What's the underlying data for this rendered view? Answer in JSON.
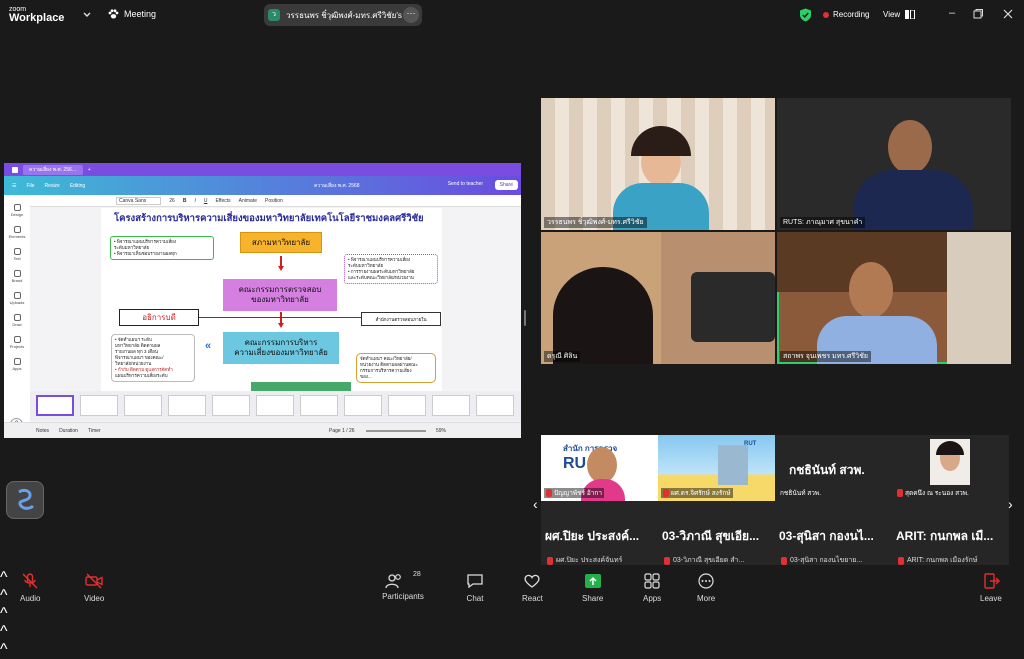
{
  "app": {
    "brand_line1": "zoom",
    "brand_line2": "Workplace",
    "meeting_label": "Meeting",
    "share_tab_title": "วรรธนพร  ชิ๋วุฒิพงศ์-มทร.ศรีวิชัย's sc",
    "share_tab_icon": "ว",
    "recording_label": "Recording",
    "view_label": "View"
  },
  "canva": {
    "tab_title": "ความเสี่ยง พ.ศ. 256…",
    "menu": [
      "File",
      "Resize",
      "Editing"
    ],
    "doc_title": "ความเสี่ยง พ.ศ. 2568",
    "send_to_teacher": "Send to teacher",
    "share_label": "Share",
    "font_name": "Canva Sans",
    "font_size": "26",
    "tool_items": [
      "Effects",
      "Animate",
      "Position"
    ],
    "left_panel": [
      "Design",
      "Elements",
      "Text",
      "Brand",
      "Uploads",
      "Draw",
      "Projects",
      "Apps"
    ],
    "slide": {
      "title": "โครงสร้างการบริหารความเสี่ยงของมหาวิทยาลัยเทคโนโลยีราชมงคลศรีวิชัย",
      "box1": "สภามหาวิทยาลัย",
      "box2_line1": "คณะกรรมการตรวจสอบ",
      "box2_line2": "ของมหาวิทยาลัย",
      "box3_line1": "คณะกรรมการบริหาร",
      "box3_line2": "ความเสี่ยงของมหาวิทยาลัย",
      "box_left": "อธิการบดี",
      "box_right": "สำนักงานตรวจสอบภายใน",
      "note_tl_1": "• พิจารณาแผนบริหารความเสี่ยง",
      "note_tl_2": "ระดับมหาวิทยาลัย",
      "note_tl_3": "• พิจารณาเห็นชอบรายงานผลทุก",
      "note_tr_1": "• พิจารณาแผนบริหารความเสี่ยง",
      "note_tr_2": "ระดับมหาวิทยาลัย",
      "note_tr_3": "• การรายงานผลระดับมหาวิทยาลัย",
      "note_tr_4": "และระดับคณะ/วิทยาลัย/หน่วยงาน",
      "note_bl_1": "• จัดทำแผนฯ ระดับ",
      "note_bl_2": "มหาวิทยาลัย ติดตามผล",
      "note_bl_3": "รายงานผล ทุก 3 เดือน",
      "note_bl_4": "พิจารณาแผนฯ ของคณะ/",
      "note_bl_5": "วิทยาลัย/หน่วยงาน",
      "note_bl_6": "• กำกับ ติดตาม ดูแลการจัดทำ",
      "note_bl_7": "แผนบริหารความเสี่ยงระดับ",
      "note_br_1": "จัดทำแผนฯ คณะ/วิทยาลัย/",
      "note_br_2": "หน่วยงาน ติดตามผลผ่านคณะ",
      "note_br_3": "กรรมการบริหารความเสี่ยง",
      "note_br_4": "ของ..."
    },
    "bottom": {
      "notes": "Notes",
      "duration": "Duration",
      "timer": "Timer",
      "page": "Page 1 / 26",
      "zoom": "59%"
    }
  },
  "tiles": [
    {
      "name": "วรรธนพร  ชิ๋วุฒิพงศ์-มทร.ศรีวิชัย"
    },
    {
      "name": "RUTS: ภาณุมาศ สุขนาคำ"
    },
    {
      "name": "ดรุณี ศิลิน"
    },
    {
      "name": "สถาพร จุนเพชร มทร.ศรีวิชัย"
    }
  ],
  "strip": [
    {
      "frame_name": "ปัญญาพัชร์ อ้ากา",
      "big": "ผศ.ปิยะ  ประสงค์...",
      "small": "ผศ.ปิยะ  ประสงค์จันทร์",
      "overlay": "สำนัก    การตรวจ"
    },
    {
      "frame_name": "ผศ.ดร.จิศรักษ์ สงรักษ์",
      "big": "03-วิภาณี สุขเอีย...",
      "small": "03-วิภาณี สุขเอียด สำ..."
    },
    {
      "frame_name": "กชธินันท์ สวพ.",
      "big": "03-สุนิสา กองนไ...",
      "small": "03-สุนิสา กองนไขยาย...",
      "frame_big": "กชธินันท์  สวพ."
    },
    {
      "frame_name": "สุดคนึง ณ ระนอง สวพ.",
      "big": "ARIT: กนกพล  เมื...",
      "small": "ARIT: กนกพล เมืองรักษ์"
    }
  ],
  "toolbar": {
    "audio": "Audio",
    "video": "Video",
    "participants": "Participants",
    "participant_count": "28",
    "chat": "Chat",
    "react": "React",
    "share": "Share",
    "apps": "Apps",
    "more": "More",
    "leave": "Leave"
  },
  "colors": {
    "accent_green": "#2bd06a",
    "recording_red": "#e03030",
    "canva_purple": "#7b4ce0",
    "share_green": "#22b04a"
  }
}
